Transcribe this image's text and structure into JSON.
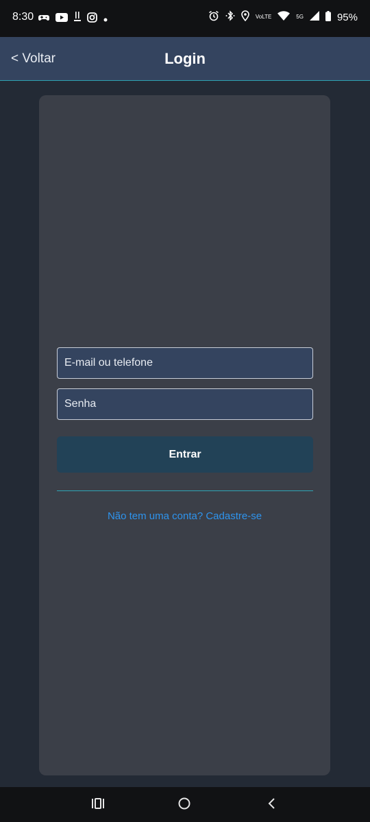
{
  "status_bar": {
    "time": "8:30",
    "battery": "95%",
    "network": "5G",
    "volte": "VoLTE",
    "icons": [
      "game-controller-icon",
      "youtube-icon",
      "tasks-icon",
      "instagram-icon",
      "dot-icon",
      "alarm-icon",
      "bluetooth-icon",
      "location-icon",
      "volte-icon",
      "wifi-icon",
      "signal-icon",
      "battery-icon"
    ]
  },
  "header": {
    "back_label": "< Voltar",
    "title": "Login"
  },
  "form": {
    "email_placeholder": "E-mail ou telefone",
    "password_placeholder": "Senha",
    "submit_label": "Entrar",
    "signup_link": "Não tem uma conta? Cadastre-se"
  },
  "nav_bar": {
    "icons": [
      "recent-apps-icon",
      "home-icon",
      "back-icon"
    ]
  },
  "colors": {
    "status_bar_bg": "#111214",
    "header_bg": "#34445f",
    "page_bg": "#232a35",
    "card_bg": "#3b3f48",
    "input_bg": "#34445f",
    "button_bg": "#224257",
    "accent_line": "#2fa6b6",
    "link": "#2e94ee"
  }
}
